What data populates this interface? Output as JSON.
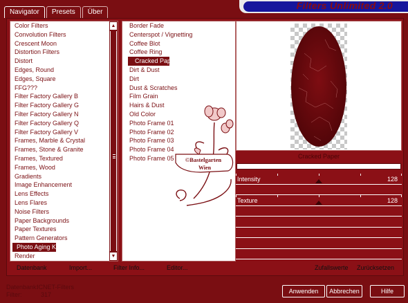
{
  "tabs": [
    {
      "label": "Navigator",
      "active": true
    },
    {
      "label": "Presets",
      "active": false
    },
    {
      "label": "Über",
      "active": false
    }
  ],
  "title": "Filters Unlimited 2.0",
  "categories": {
    "items": [
      "Color Filters",
      "Convolution Filters",
      "Crescent Moon",
      "Distortion Filters",
      "Distort",
      "Edges, Round",
      "Edges, Square",
      "FFG???",
      "Filter Factory Gallery B",
      "Filter Factory Gallery G",
      "Filter Factory Gallery N",
      "Filter Factory Gallery Q",
      "Filter Factory Gallery V",
      "Frames, Marble & Crystal",
      "Frames, Stone & Granite",
      "Frames, Textured",
      "Frames, Wood",
      "Gradients",
      "Image Enhancement",
      "Lens Effects",
      "Lens Flares",
      "Noise Filters",
      "Paper Backgrounds",
      "Paper Textures",
      "Pattern Generators",
      "Photo Aging Kit",
      "Render"
    ],
    "selected": "Photo Aging Kit"
  },
  "filters": {
    "items": [
      "Border Fade",
      "Centerspot / Vignetting",
      "Coffee Blot",
      "Coffee Ring",
      "Cracked Paper",
      "Dirt & Dust",
      "Dirt",
      "Dust & Scratches",
      "Film Grain",
      "Hairs & Dust",
      "Old Color",
      "Photo Frame 01",
      "Photo Frame 02",
      "Photo Frame 03",
      "Photo Frame 04",
      "Photo Frame 05"
    ],
    "selected": "Cracked Paper"
  },
  "watermark": {
    "line1": "©Bastelgarten",
    "line2": "Wien"
  },
  "preview": {
    "filter_name": "Cracked Paper"
  },
  "sliders": [
    {
      "label": "Intensity",
      "value": "128",
      "fraction": 0.5
    },
    {
      "label": "Texture",
      "value": "128",
      "fraction": 0.5
    }
  ],
  "toolbar": {
    "database": "Datenbank",
    "import": "Import...",
    "filter_info": "Filter Info...",
    "editor": "Editor...",
    "random": "Zufallswerte",
    "reset": "Zurücksetzen"
  },
  "status": {
    "db_key": "Datenbank:",
    "db_value": "ICNET-Filters",
    "filters_key": "Filter:",
    "filters_value": "317"
  },
  "buttons": {
    "apply": "Anwenden",
    "cancel": "Abbrechen",
    "help": "Hilfe"
  },
  "colors": {
    "background": "#7a0e12",
    "panel": "#8b1016",
    "title_bar": "#16169c",
    "oval": "#6b0a0e"
  }
}
